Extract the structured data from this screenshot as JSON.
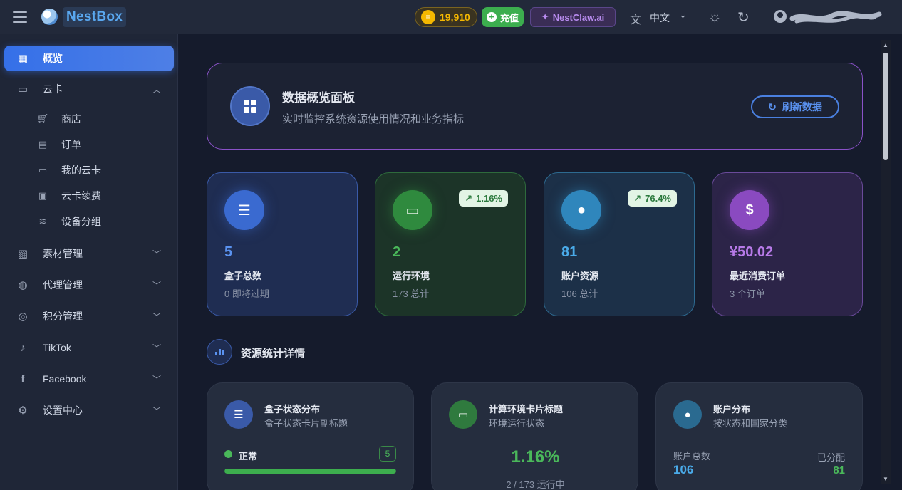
{
  "header": {
    "brand": "NestBox",
    "coins": "19,910",
    "recharge_label": "充值",
    "claw_label": "NestClaw.ai",
    "language": "中文"
  },
  "sidebar": {
    "items": [
      {
        "label": "概览",
        "icon": "dashboard-icon",
        "active": true
      },
      {
        "label": "云卡",
        "icon": "card-icon",
        "expanded": true
      },
      {
        "label": "素材管理",
        "icon": "media-icon"
      },
      {
        "label": "代理管理",
        "icon": "globe-icon"
      },
      {
        "label": "积分管理",
        "icon": "coins-icon"
      },
      {
        "label": "TikTok",
        "icon": "tiktok-icon"
      },
      {
        "label": "Facebook",
        "icon": "facebook-icon"
      },
      {
        "label": "设置中心",
        "icon": "gear-icon"
      }
    ],
    "subitems": [
      {
        "label": "商店",
        "icon": "cart-icon"
      },
      {
        "label": "订单",
        "icon": "receipt-icon"
      },
      {
        "label": "我的云卡",
        "icon": "card-icon"
      },
      {
        "label": "云卡续费",
        "icon": "renew-icon"
      },
      {
        "label": "设备分组",
        "icon": "layers-icon"
      }
    ]
  },
  "hero": {
    "title": "数据概览面板",
    "subtitle": "实时监控系统资源使用情况和业务指标",
    "refresh_label": "刷新数据"
  },
  "stats": [
    {
      "value": "5",
      "label": "盒子总数",
      "sub": "0 即将过期"
    },
    {
      "value": "2",
      "label": "运行环境",
      "sub": "173 总计",
      "badge": "1.16%"
    },
    {
      "value": "81",
      "label": "账户资源",
      "sub": "106 总计",
      "badge": "76.4%"
    },
    {
      "value": "¥50.02",
      "label": "最近消费订单",
      "sub": "3 个订单"
    }
  ],
  "section": {
    "title": "资源统计详情"
  },
  "cards": {
    "box": {
      "title": "盒子状态分布",
      "subtitle": "盒子状态卡片副标题",
      "status_label": "正常",
      "status_count": "5",
      "progress": 1.0
    },
    "env": {
      "title": "计算环境卡片标题",
      "subtitle": "环境运行状态",
      "percent": "1.16%",
      "detail": "2 / 173 运行中"
    },
    "account": {
      "title": "账户分布",
      "subtitle": "按状态和国家分类",
      "total_label": "账户总数",
      "total_value": "106",
      "assigned_label": "已分配",
      "assigned_value": "81"
    }
  },
  "colors": {
    "accent": "#3570e8",
    "green": "#4ab85a",
    "purple": "#8a4ac0",
    "gold": "#f5b800"
  }
}
